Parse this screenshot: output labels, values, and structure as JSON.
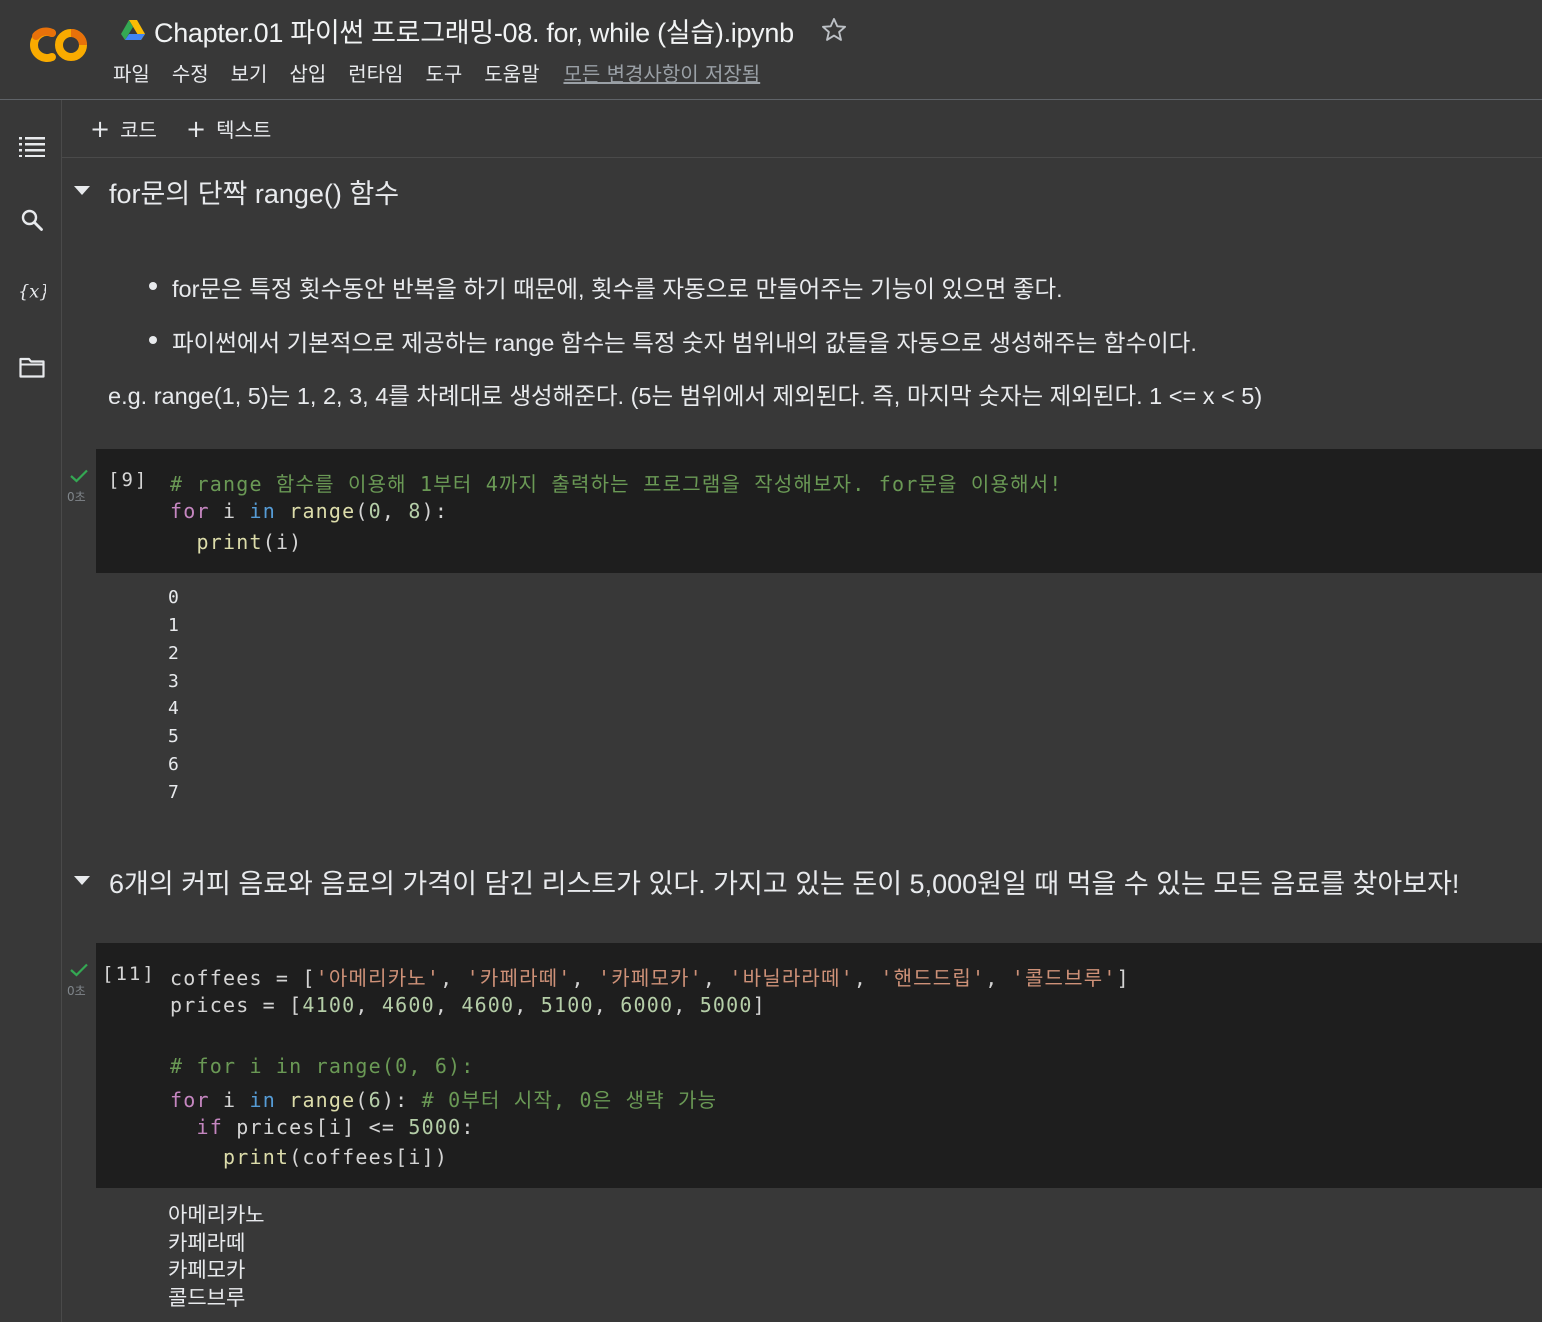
{
  "app": {
    "doc_title": "Chapter.01 파이썬 프로그래밍-08. for, while (실습).ipynb",
    "menu": [
      "파일",
      "수정",
      "보기",
      "삽입",
      "런타임",
      "도구",
      "도움말"
    ],
    "save_status": "모든 변경사항이 저장됨"
  },
  "toolbar": {
    "add_code": "코드",
    "add_text": "텍스트"
  },
  "cells": {
    "text1": {
      "title": "for문의 단짝 range() 함수",
      "bullets": [
        "for문은 특정 횟수동안 반복을 하기 때문에, 횟수를 자동으로 만들어주는 기능이 있으면 좋다.",
        "파이썬에서 기본적으로 제공하는 range 함수는 특정 숫자 범위내의 값들을 자동으로 생성해주는 함수이다."
      ],
      "paragraph": "e.g. range(1, 5)는 1, 2, 3, 4를 차례대로 생성해준다. (5는 범위에서 제외된다. 즉, 마지막 숫자는 제외된다. 1 <= x < 5)"
    },
    "code1": {
      "exec_count": "[9]",
      "exec_time": "0초",
      "outputs": [
        "0",
        "1",
        "2",
        "3",
        "4",
        "5",
        "6",
        "7"
      ]
    },
    "text2": {
      "title": "6개의 커피 음료와 음료의 가격이 담긴 리스트가 있다. 가지고 있는 돈이 5,000원일 때 먹을 수 있는 모든 음료를 찾아보자!"
    },
    "code2": {
      "exec_count": "[11]",
      "exec_time": "0초",
      "outputs": [
        "아메리카노",
        "카페라떼",
        "카페모카",
        "콜드브루"
      ]
    }
  }
}
